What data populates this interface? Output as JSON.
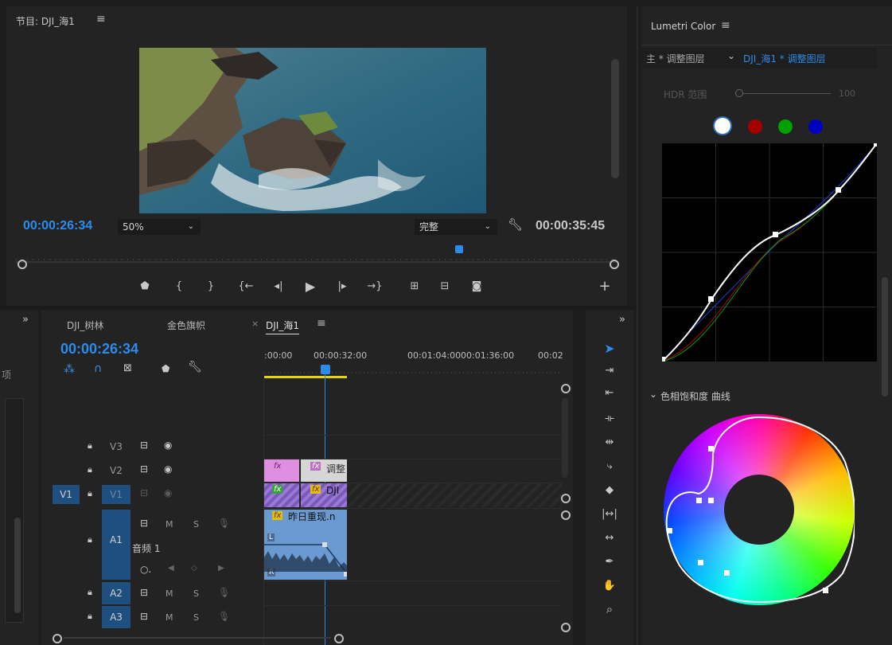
{
  "program_monitor": {
    "title": "节目: DJI_海1",
    "current_time": "00:00:26:34",
    "zoom": "50%",
    "quality": "完整",
    "duration": "00:00:35:45"
  },
  "lumetri": {
    "title": "Lumetri Color",
    "path_left": "主 * 调整图层",
    "path_right": "DJI_海1 * 调整图层",
    "hdr_label": "HDR 范围",
    "hdr_value": "100",
    "section_hsl": "色相饱和度 曲线",
    "channels": [
      "white",
      "red",
      "green",
      "blue"
    ],
    "colors": {
      "white": "#ffffff",
      "red": "#a30000",
      "green": "#00a000",
      "blue": "#0000c0"
    }
  },
  "timeline": {
    "tabs": [
      "DJI_树林",
      "金色旗帜",
      "DJI_海1"
    ],
    "active_tab": "DJI_海1",
    "timecode": "00:00:26:34",
    "ruler": [
      ":00:00",
      "00:00:32:00",
      "00:01:04:00",
      "00:01:36:00",
      "00:02"
    ],
    "tracks": {
      "v3": "V3",
      "v2": "V2",
      "v1": "V1",
      "v1_src": "V1",
      "a1": "A1",
      "a1_name": "音频 1",
      "a2": "A2",
      "a3": "A3"
    },
    "mute_label": "M",
    "solo_label": "S",
    "clips": {
      "v2_a": "fx",
      "v2_b_fx": "fx",
      "v2_b": "调整",
      "v1_a": "fx",
      "v1_b_fx": "fx",
      "v1_b": "DJI",
      "a1_fx": "fx",
      "a1": "昨日重现.n",
      "a1_l": "L",
      "a1_r": "R"
    }
  },
  "left_panel": {
    "label": "项"
  }
}
